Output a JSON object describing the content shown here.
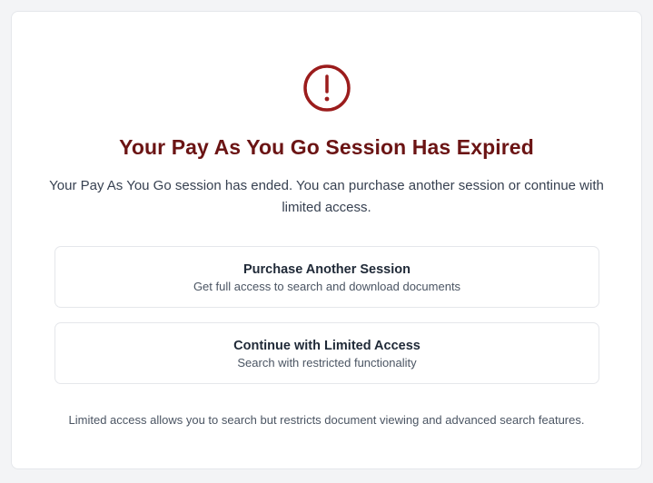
{
  "dialog": {
    "icon": "exclamation-circle-icon",
    "title": "Your Pay As You Go Session Has Expired",
    "description": "Your Pay As You Go session has ended. You can purchase another session or continue with limited access.",
    "options": [
      {
        "title": "Purchase Another Session",
        "subtitle": "Get full access to search and download documents"
      },
      {
        "title": "Continue with Limited Access",
        "subtitle": "Search with restricted functionality"
      }
    ],
    "footnote": "Limited access allows you to search but restricts document viewing and advanced search features."
  },
  "colors": {
    "accent": "#9b1c1c",
    "title": "#6b1414",
    "background": "#f3f4f6",
    "card": "#ffffff",
    "border": "#e5e7eb"
  }
}
